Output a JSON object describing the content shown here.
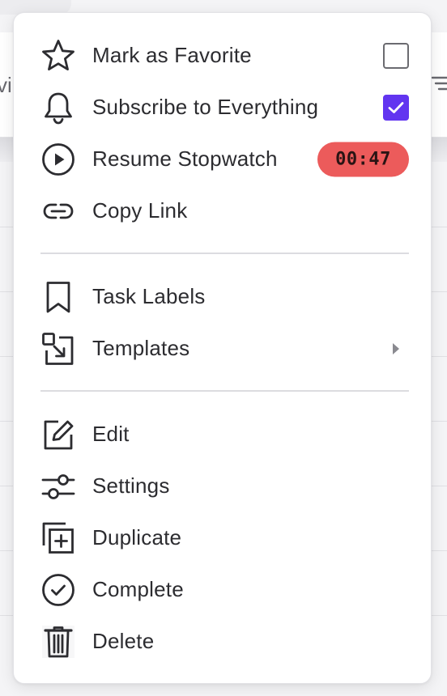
{
  "background": {
    "left_text": "vi"
  },
  "menu": {
    "section1": [
      {
        "id": "favorite",
        "label": "Mark as Favorite",
        "icon": "star-icon",
        "checkbox": false
      },
      {
        "id": "subscribe",
        "label": "Subscribe to Everything",
        "icon": "bell-icon",
        "checkbox": true
      },
      {
        "id": "stopwatch",
        "label": "Resume Stopwatch",
        "icon": "play-circle-icon",
        "badge": "00:47"
      },
      {
        "id": "copy-link",
        "label": "Copy Link",
        "icon": "link-icon"
      }
    ],
    "section2": [
      {
        "id": "task-labels",
        "label": "Task Labels",
        "icon": "bookmark-icon"
      },
      {
        "id": "templates",
        "label": "Templates",
        "icon": "template-icon",
        "submenu": true
      }
    ],
    "section3": [
      {
        "id": "edit",
        "label": "Edit",
        "icon": "edit-icon"
      },
      {
        "id": "settings",
        "label": "Settings",
        "icon": "sliders-icon"
      },
      {
        "id": "duplicate",
        "label": "Duplicate",
        "icon": "duplicate-icon"
      },
      {
        "id": "complete",
        "label": "Complete",
        "icon": "check-circle-icon"
      },
      {
        "id": "delete",
        "label": "Delete",
        "icon": "trash-icon"
      }
    ],
    "stopwatch_badge": "00:47",
    "colors": {
      "accent": "#6235f0",
      "badge": "#ec5b5b",
      "text": "#2c2c30",
      "icon": "#2c2c30"
    }
  }
}
